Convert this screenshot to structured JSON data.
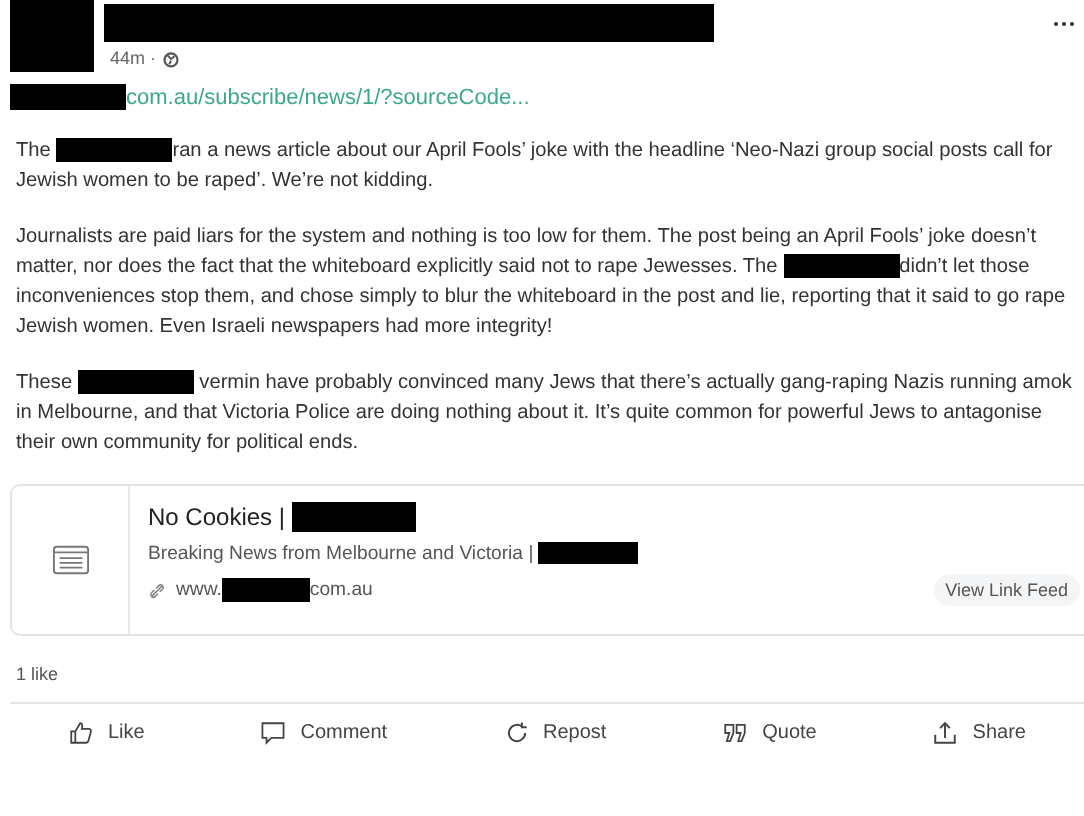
{
  "post": {
    "author_redacted": true,
    "time": "44m ·",
    "link": [
      {
        "kind": "redaction"
      },
      {
        "kind": "text",
        "text": "com.au/subscribe/news/1/?sourceCode..."
      }
    ],
    "paragraphs": [
      [
        {
          "kind": "text",
          "text": "The "
        },
        {
          "kind": "redaction"
        },
        {
          "kind": "text",
          "text": "ran a news article about our April Fools’ joke with the headline ‘Neo-Nazi group social posts call for Jewish women to be raped’. We’re not kidding."
        }
      ],
      [
        {
          "kind": "text",
          "text": "Journalists are paid liars for the system and nothing is too low for them. The post being an April Fools’ joke doesn’t matter, nor does the fact that the whiteboard explicitly said not to rape Jewesses. The "
        },
        {
          "kind": "redaction"
        },
        {
          "kind": "text",
          "text": "didn’t let those inconveniences stop them, and chose simply to blur the whiteboard in the post and lie, reporting that it said to go rape Jewish women. Even Israeli newspapers had more integrity!"
        }
      ],
      [
        {
          "kind": "text",
          "text": "These "
        },
        {
          "kind": "redaction"
        },
        {
          "kind": "text",
          "text": " vermin have probably convinced many Jews that there’s actually gang-raping Nazis running amok in Melbourne, and that Victoria Police are doing nothing about it. It’s quite common for powerful Jews to antagonise their own community for political ends."
        }
      ]
    ]
  },
  "link_card": {
    "title": [
      {
        "kind": "text",
        "text": "No Cookies | "
      },
      {
        "kind": "redaction"
      }
    ],
    "description": [
      {
        "kind": "text",
        "text": "Breaking News from Melbourne and Victoria | "
      },
      {
        "kind": "redaction"
      }
    ],
    "url": [
      {
        "kind": "text",
        "text": "www."
      },
      {
        "kind": "redaction"
      },
      {
        "kind": "text",
        "text": "com.au"
      }
    ],
    "button": "View Link Feed"
  },
  "likes": "1 like",
  "actions": [
    {
      "kind": "like",
      "label": "Like"
    },
    {
      "kind": "comment",
      "label": "Comment"
    },
    {
      "kind": "repost",
      "label": "Repost"
    },
    {
      "kind": "quote",
      "label": "Quote"
    },
    {
      "kind": "share",
      "label": "Share"
    }
  ]
}
